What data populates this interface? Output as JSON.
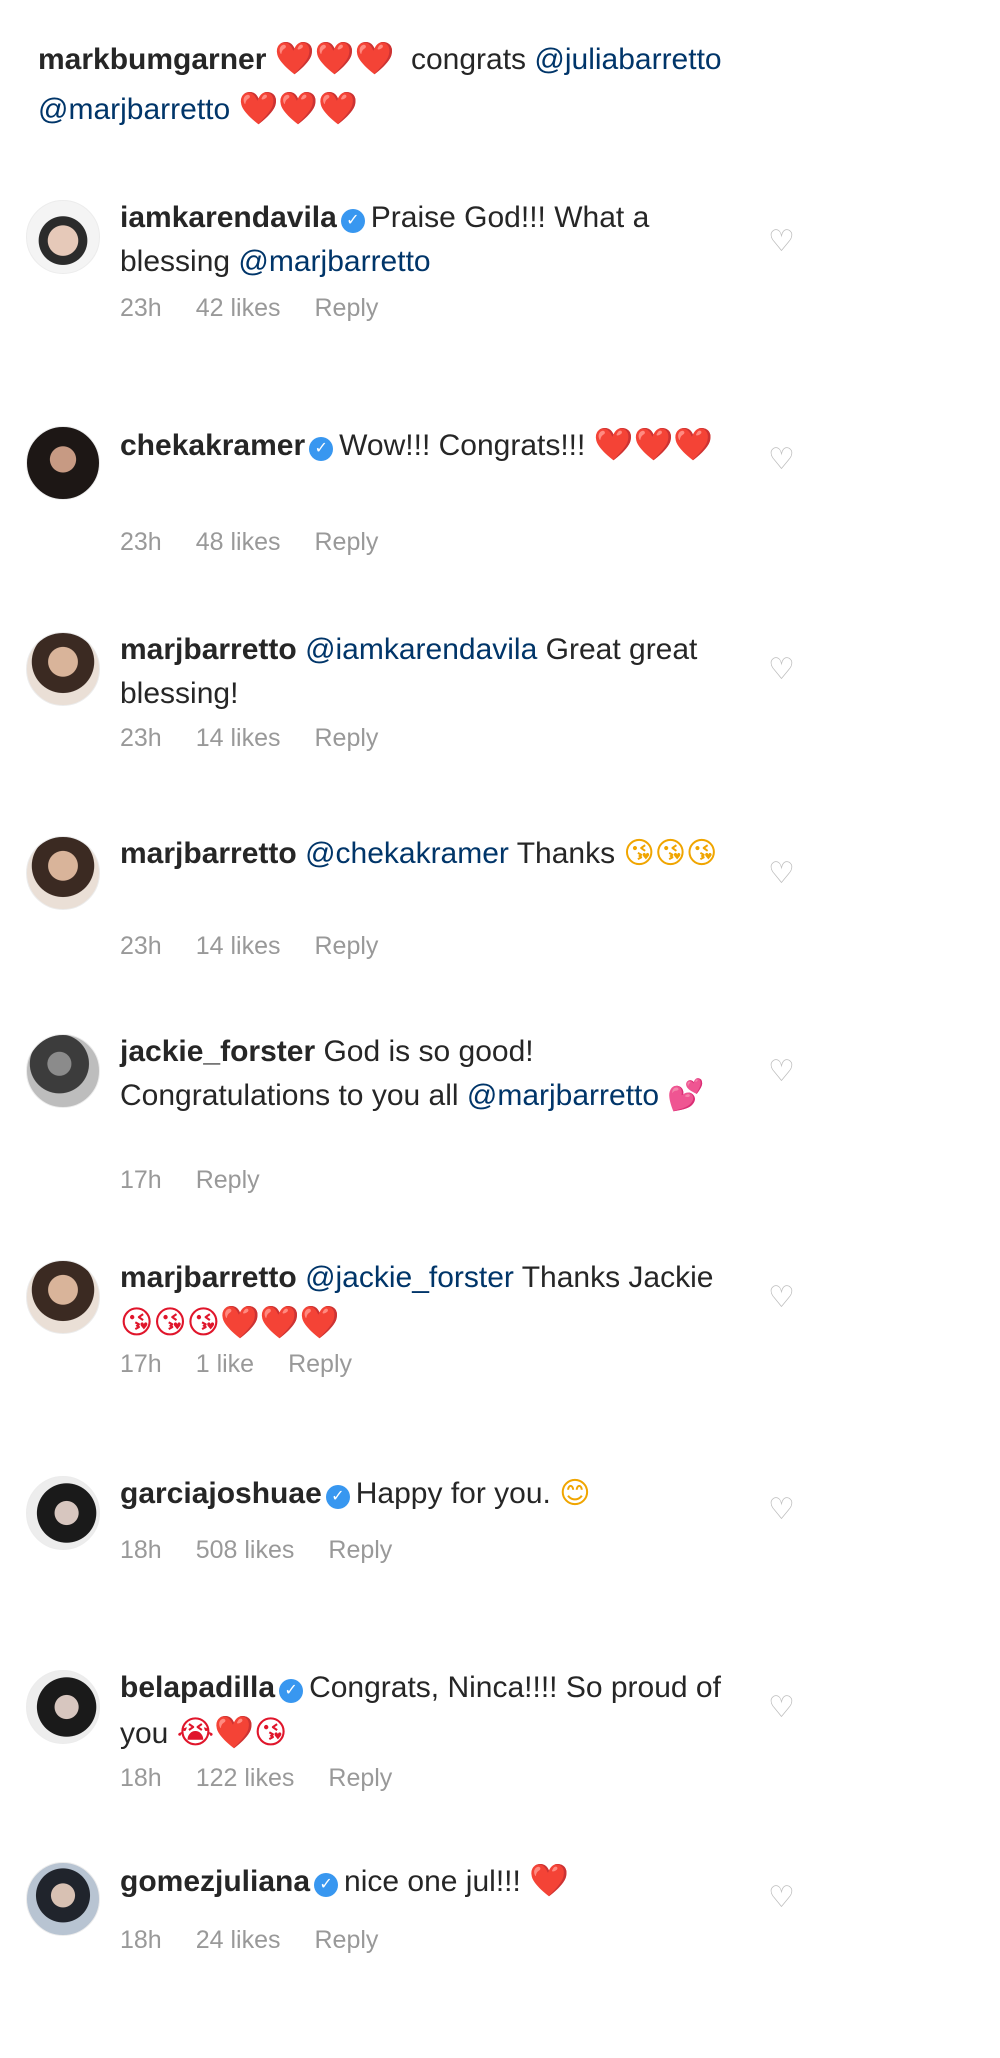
{
  "caption": {
    "username": "markbumgarner",
    "hearts_before": "❤️❤️❤️",
    "text": "congrats",
    "mention1": "@juliabarretto",
    "mention2": "@marjbarretto",
    "hearts_after": "❤️❤️❤️"
  },
  "comments": [
    {
      "username": "iamkarendavila",
      "verified": true,
      "text": "Praise God!!! What a blessing",
      "mention": "@marjbarretto",
      "time": "23h",
      "likes": "42 likes",
      "reply": "Reply"
    },
    {
      "username": "chekakramer",
      "verified": true,
      "text": "Wow!!! Congrats!!!",
      "emoji": "❤️❤️❤️",
      "time": "23h",
      "likes": "48 likes",
      "reply": "Reply"
    },
    {
      "username": "marjbarretto",
      "mention": "@iamkarendavila",
      "text": "Great great blessing!",
      "time": "23h",
      "likes": "14 likes",
      "reply": "Reply"
    },
    {
      "username": "marjbarretto",
      "mention": "@chekakramer",
      "text": "Thanks",
      "emoji": "😘😘😘",
      "time": "23h",
      "likes": "14 likes",
      "reply": "Reply"
    },
    {
      "username": "jackie_forster",
      "text": "God is so good! Congratulations to you all",
      "mention": "@marjbarretto",
      "emoji": "💕",
      "time": "17h",
      "reply": "Reply"
    },
    {
      "username": "marjbarretto",
      "mention": "@jackie_forster",
      "text": "Thanks Jackie",
      "emoji": "😘😘😘❤️❤️❤️",
      "time": "17h",
      "likes": "1 like",
      "reply": "Reply"
    },
    {
      "username": "garciajoshuae",
      "verified": true,
      "text": "Happy for you.",
      "emoji": "😊",
      "time": "18h",
      "likes": "508 likes",
      "reply": "Reply"
    },
    {
      "username": "belapadilla",
      "verified": true,
      "text": "Congrats, Ninca!!!! So proud of you",
      "emoji": "😭❤️😘",
      "time": "18h",
      "likes": "122 likes",
      "reply": "Reply"
    },
    {
      "username": "gomezjuliana",
      "verified": true,
      "text": "nice one jul!!!",
      "emoji": "❤️",
      "time": "18h",
      "likes": "24 likes",
      "reply": "Reply"
    }
  ],
  "icons": {
    "like": "heart-outline-icon",
    "verified": "verified-badge-icon"
  },
  "colors": {
    "username": "#262626",
    "mention": "#003569",
    "meta": "#999999",
    "verified": "#3897f0",
    "heart": "#e0152b"
  }
}
